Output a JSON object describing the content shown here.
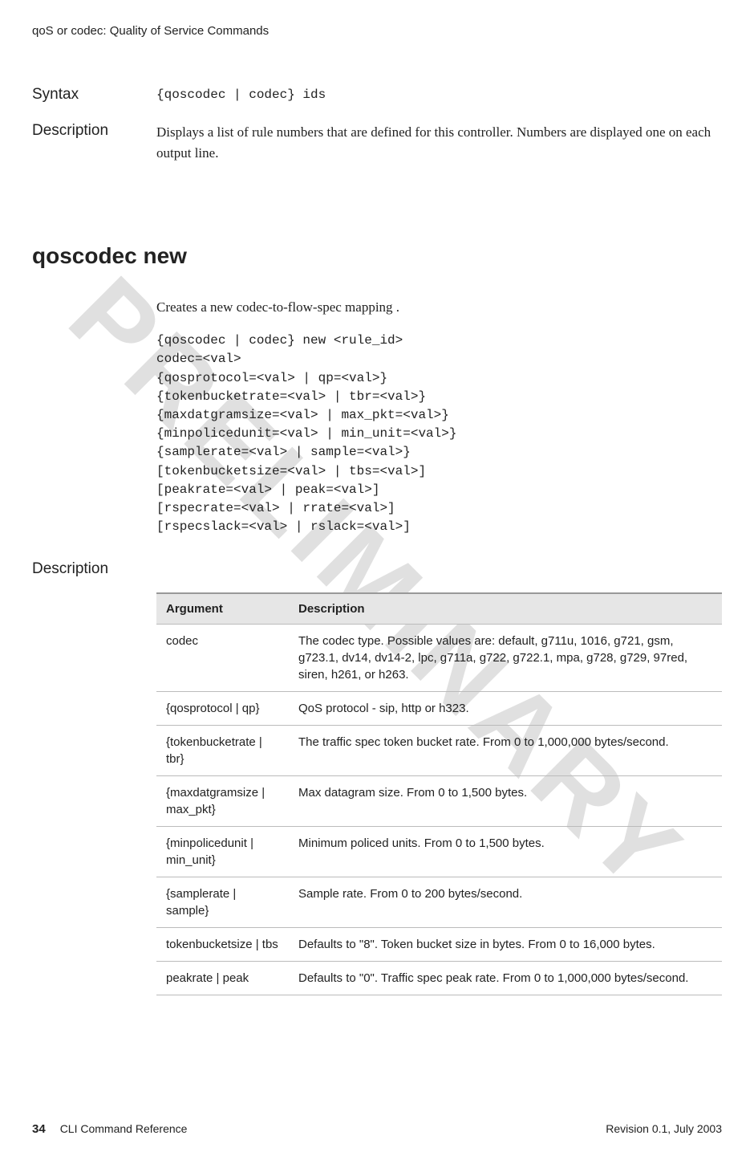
{
  "header": {
    "breadcrumb": "qoS or codec: Quality of Service Commands"
  },
  "watermark": "PRELIMINARY",
  "syntax_row": {
    "label": "Syntax",
    "code": "{qoscodec | codec} ids"
  },
  "description_row": {
    "label": "Description",
    "text": "Displays a list of rule numbers that are defined for this controller. Numbers are displayed one on each output line."
  },
  "command": {
    "heading": "qoscodec new",
    "intro": "Creates a new codec-to-flow-spec mapping .",
    "syntax": "{qoscodec | codec} new <rule_id>\ncodec=<val>\n{qosprotocol=<val> | qp=<val>}\n{tokenbucketrate=<val> | tbr=<val>}\n{maxdatgramsize=<val> | max_pkt=<val>}\n{minpolicedunit=<val> | min_unit=<val>}\n{samplerate=<val> | sample=<val>}\n[tokenbucketsize=<val> | tbs=<val>]\n[peakrate=<val> | peak=<val>]\n[rspecrate=<val> | rrate=<val>]\n[rspecslack=<val> | rslack=<val>]"
  },
  "desc2_label": "Description",
  "table": {
    "head_argument": "Argument",
    "head_description": "Description",
    "rows": [
      {
        "arg": "codec",
        "desc": "The codec type. Possible values are: default, g711u, 1016, g721, gsm, g723.1, dv14, dv14-2, lpc, g711a, g722, g722.1, mpa, g728, g729, 97red, siren, h261, or h263."
      },
      {
        "arg": "{qosprotocol | qp}",
        "desc": "QoS protocol - sip, http or h323."
      },
      {
        "arg": "{tokenbucketrate | tbr}",
        "desc": "The traffic spec token bucket rate. From 0 to 1,000,000 bytes/second."
      },
      {
        "arg": " {maxdatgramsize | max_pkt}",
        "desc": "Max datagram size. From 0 to 1,500 bytes."
      },
      {
        "arg": "{minpolicedunit | min_unit}",
        "desc": "Minimum policed units. From 0 to 1,500 bytes."
      },
      {
        "arg": "{samplerate | sample}",
        "desc": "Sample rate. From 0 to 200 bytes/second."
      },
      {
        "arg": "tokenbucketsize | tbs",
        "desc": "Defaults to \"8\". Token bucket size in bytes. From 0 to 16,000 bytes."
      },
      {
        "arg": "peakrate | peak",
        "desc": "Defaults to \"0\". Traffic spec peak rate. From 0 to 1,000,000 bytes/second."
      }
    ]
  },
  "footer": {
    "page_number": "34",
    "doc_title": "CLI Command Reference",
    "revision": "Revision 0.1, July 2003"
  }
}
